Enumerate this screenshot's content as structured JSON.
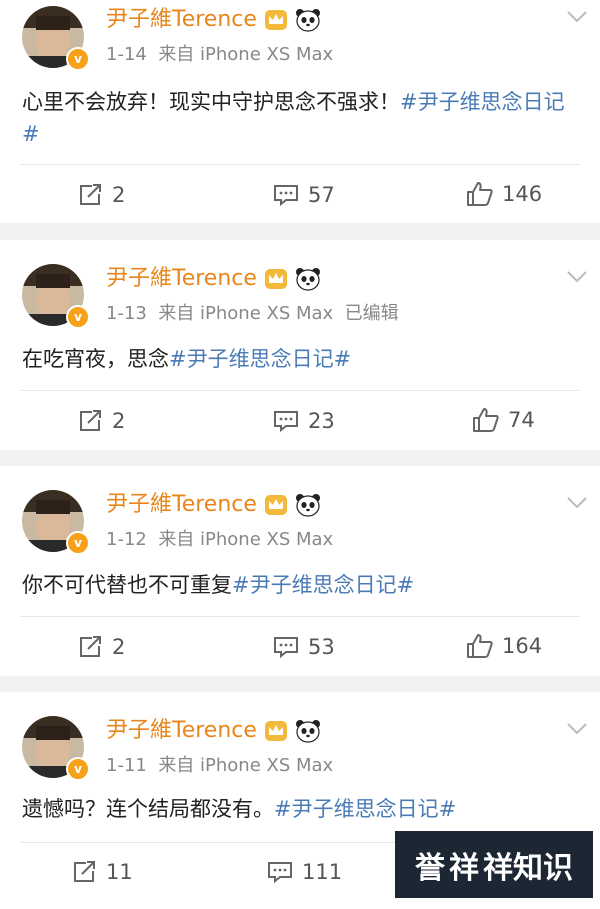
{
  "posts": [
    {
      "author": "尹子維Terence",
      "date": "1-14",
      "source": "来自 iPhone XS Max",
      "edited": "",
      "text": "心里不会放弃！现实中守护思念不强求！",
      "tag": "#尹子维思念日记#",
      "reposts": "2",
      "comments": "57",
      "likes": "146"
    },
    {
      "author": "尹子維Terence",
      "date": "1-13",
      "source": "来自 iPhone XS Max",
      "edited": "已编辑",
      "text": "在吃宵夜，思念",
      "tag": "#尹子维思念日记#",
      "reposts": "2",
      "comments": "23",
      "likes": "74"
    },
    {
      "author": "尹子維Terence",
      "date": "1-12",
      "source": "来自 iPhone XS Max",
      "edited": "",
      "text": "你不可代替也不可重复",
      "tag": "#尹子维思念日记#",
      "reposts": "2",
      "comments": "53",
      "likes": "164"
    },
    {
      "author": "尹子維Terence",
      "date": "1-11",
      "source": "来自 iPhone XS Max",
      "edited": "",
      "text": "遗憾吗？连个结局都没有。",
      "tag": "#尹子维思念日记#",
      "reposts": "11",
      "comments": "111",
      "likes": ""
    }
  ],
  "badge_letter": "v",
  "colors": {
    "name": "#e9861b",
    "tag": "#4a7bb7",
    "badge": "#f7a11a"
  },
  "watermark": {
    "part1": "誉",
    "part2": "祥",
    "part3": "祥知识"
  }
}
